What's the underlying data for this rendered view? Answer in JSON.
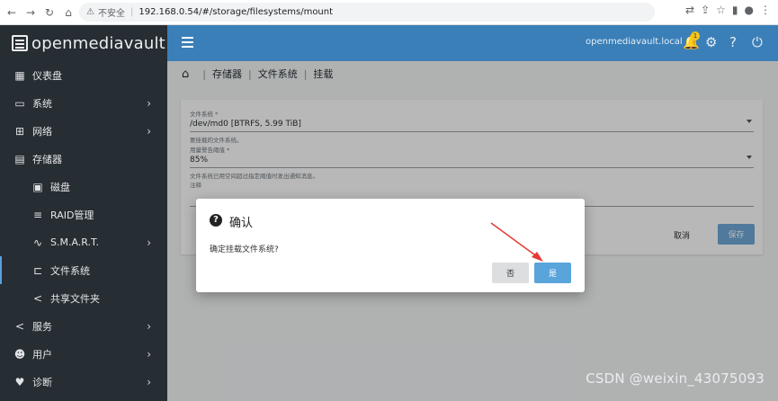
{
  "browser": {
    "security_label": "不安全",
    "url": "192.168.0.54/#/storage/filesystems/mount"
  },
  "sidebar": {
    "brand": "openmediavault",
    "items": [
      {
        "label": "仪表盘",
        "icon": "grid-icon"
      },
      {
        "label": "系统",
        "icon": "laptop-icon"
      },
      {
        "label": "网络",
        "icon": "network-icon"
      },
      {
        "label": "存储器",
        "icon": "storage-icon"
      },
      {
        "label": "磁盘",
        "icon": "disk-icon"
      },
      {
        "label": "RAID管理",
        "icon": "database-icon"
      },
      {
        "label": "S.M.A.R.T.",
        "icon": "pulse-icon"
      },
      {
        "label": "文件系统",
        "icon": "tree-icon"
      },
      {
        "label": "共享文件夹",
        "icon": "share-icon"
      },
      {
        "label": "服务",
        "icon": "share-icon"
      },
      {
        "label": "用户",
        "icon": "users-icon"
      },
      {
        "label": "诊断",
        "icon": "heartbeat-icon"
      }
    ]
  },
  "topbar": {
    "hostname": "openmediavault.local",
    "notification_count": "1"
  },
  "breadcrumb": [
    "存储器",
    "文件系统",
    "挂载"
  ],
  "form": {
    "filesystem_label": "文件系统 *",
    "filesystem_value": "/dev/md0 [BTRFS, 5.99 TiB]",
    "filesystem_hint": "要挂载的文件系统。",
    "threshold_label": "用量警告阈值 *",
    "threshold_value": "85%",
    "threshold_hint": "文件系统已用空间超过指定阈值时发出通知消息。",
    "comment_label": "注释",
    "cancel": "取消",
    "save": "保存"
  },
  "dialog": {
    "title": "确认",
    "message": "确定挂载文件系统?",
    "no": "否",
    "yes": "是"
  },
  "watermark": "CSDN @weixin_43075093"
}
